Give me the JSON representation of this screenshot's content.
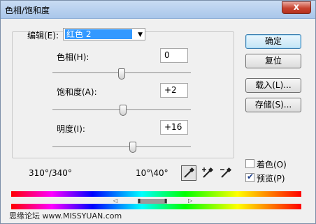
{
  "window": {
    "title": "色相/饱和度",
    "close_glyph": "x"
  },
  "edit": {
    "label": "编辑(E):",
    "value": "红色 2"
  },
  "hue": {
    "label": "色相(H):",
    "value": "0"
  },
  "saturation": {
    "label": "饱和度(A):",
    "value": "+2"
  },
  "lightness": {
    "label": "明度(I):",
    "value": "+16"
  },
  "buttons": {
    "ok": "确定",
    "reset": "复位",
    "load": "载入(L)...",
    "save": "存储(S)..."
  },
  "options": {
    "colorize": {
      "label": "着色(O)",
      "checked": false
    },
    "preview": {
      "label": "预览(P)",
      "checked": true
    }
  },
  "range": {
    "left": "310°/340°",
    "right": "10°\\40°"
  },
  "sliders": {
    "hue_fraction": 0.5,
    "saturation_fraction": 0.51,
    "lightness_fraction": 0.58
  },
  "icons": [
    "eyedropper-icon",
    "eyedropper-plus-icon",
    "eyedropper-minus-icon"
  ],
  "colors": {
    "selection": "#3399ff",
    "title_bar": "#b9d1ee",
    "close_button": "#c7432f"
  },
  "watermark": "思缘论坛  www.MISSYUAN.com"
}
